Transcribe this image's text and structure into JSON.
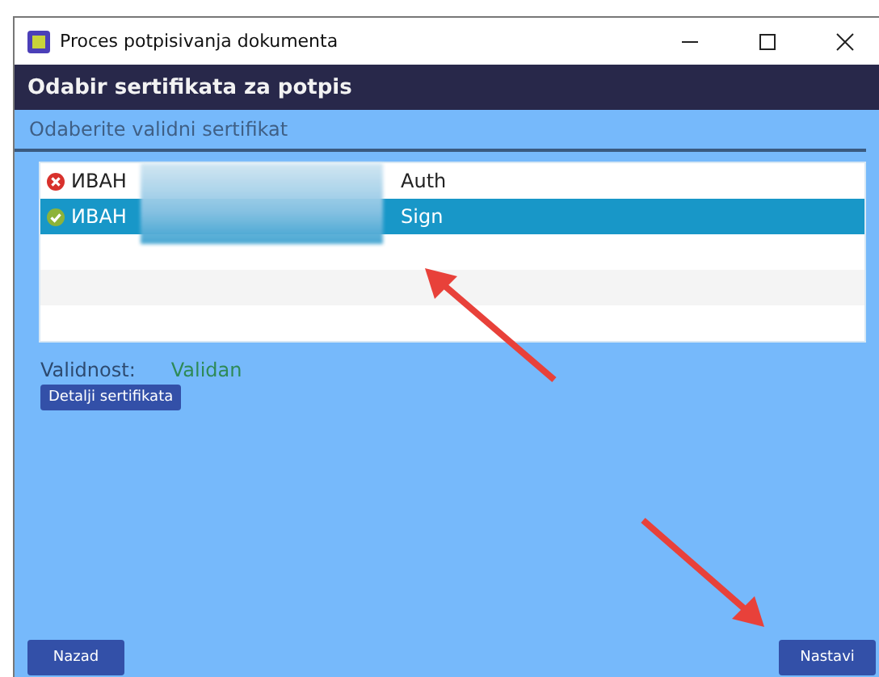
{
  "window": {
    "title": "Proces potpisivanja dokumenta"
  },
  "header": "Odabir sertifikata za potpis",
  "subheader": "Odaberite validni sertifikat",
  "certificates": [
    {
      "name": "ИВАН",
      "usage": "Auth",
      "kind": "invalid",
      "selected": false
    },
    {
      "name": "ИВАН",
      "usage": "Sign",
      "kind": "valid",
      "selected": true
    }
  ],
  "validity": {
    "label": "Validnost:",
    "value": "Validan"
  },
  "details_button": "Detalji sertifikata",
  "back_button": "Nazad",
  "next_button": "Nastavi"
}
